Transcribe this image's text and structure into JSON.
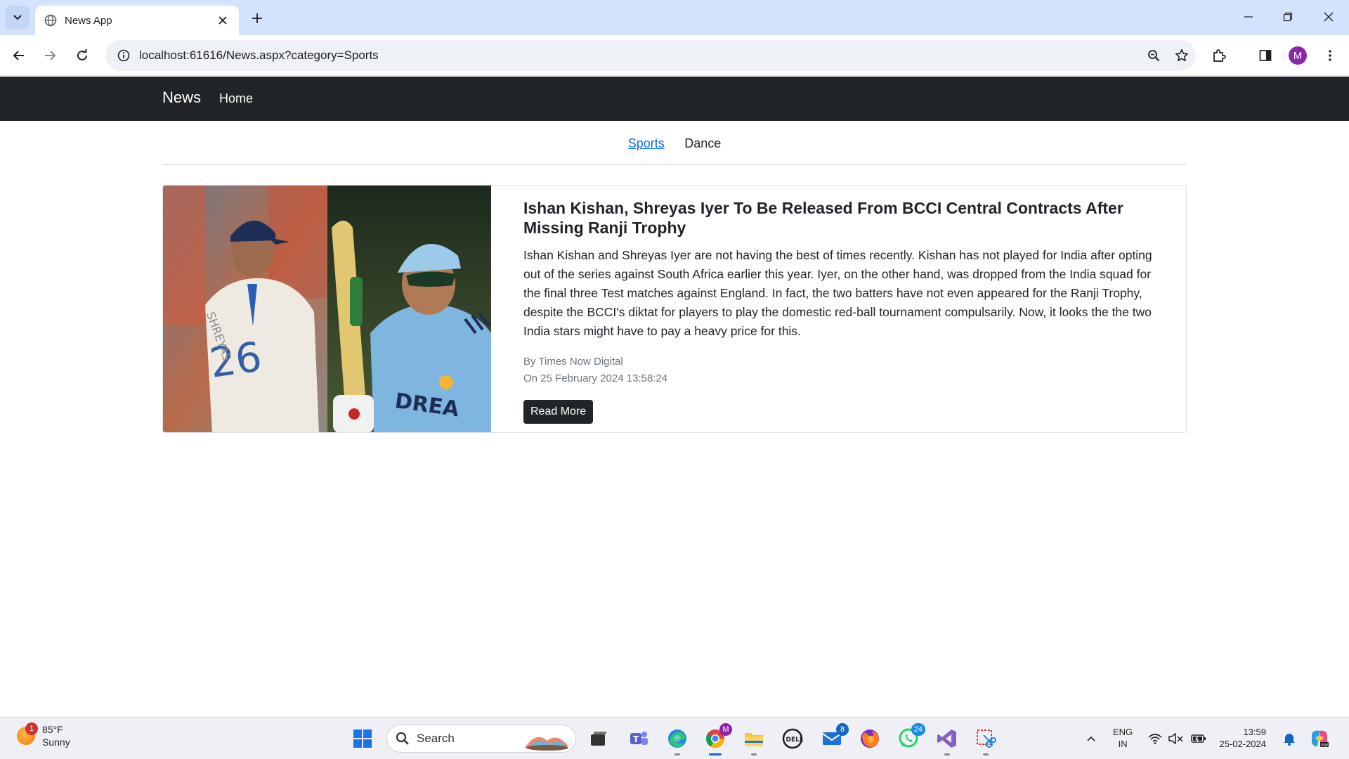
{
  "browser": {
    "tab_title": "News App",
    "url": "localhost:61616/News.aspx?category=Sports",
    "profile_initial": "M"
  },
  "site": {
    "brand": "News",
    "nav": {
      "home": "Home"
    },
    "categories": [
      {
        "label": "Sports",
        "active": true
      },
      {
        "label": "Dance",
        "active": false
      }
    ]
  },
  "article": {
    "title": "Ishan Kishan, Shreyas Iyer To Be Released From BCCI Central Contracts After Missing Ranji Trophy",
    "description": "Ishan Kishan and Shreyas Iyer are not having the best of times recently. Kishan has not played for India after opting out of the series against South Africa earlier this year. Iyer, on the other hand, was dropped from the India squad for the final three Test matches against England. In fact, the two batters have not even appeared for the Ranji Trophy, despite the BCCI's diktat for players to play the domestic red-ball tournament compulsarily. Now, it looks the the two India stars might have to pay a heavy price for this.",
    "author": "By Times Now Digital",
    "published": "On 25 February 2024 13:58:24",
    "read_more": "Read More"
  },
  "taskbar": {
    "weather_temp": "85°F",
    "weather_desc": "Sunny",
    "weather_badge": "1",
    "search_label": "Search",
    "mail_badge": "8",
    "whatsapp_badge": "24",
    "chrome_badge": "M",
    "lang_line1": "ENG",
    "lang_line2": "IN",
    "time": "13:59",
    "date": "25-02-2024"
  }
}
